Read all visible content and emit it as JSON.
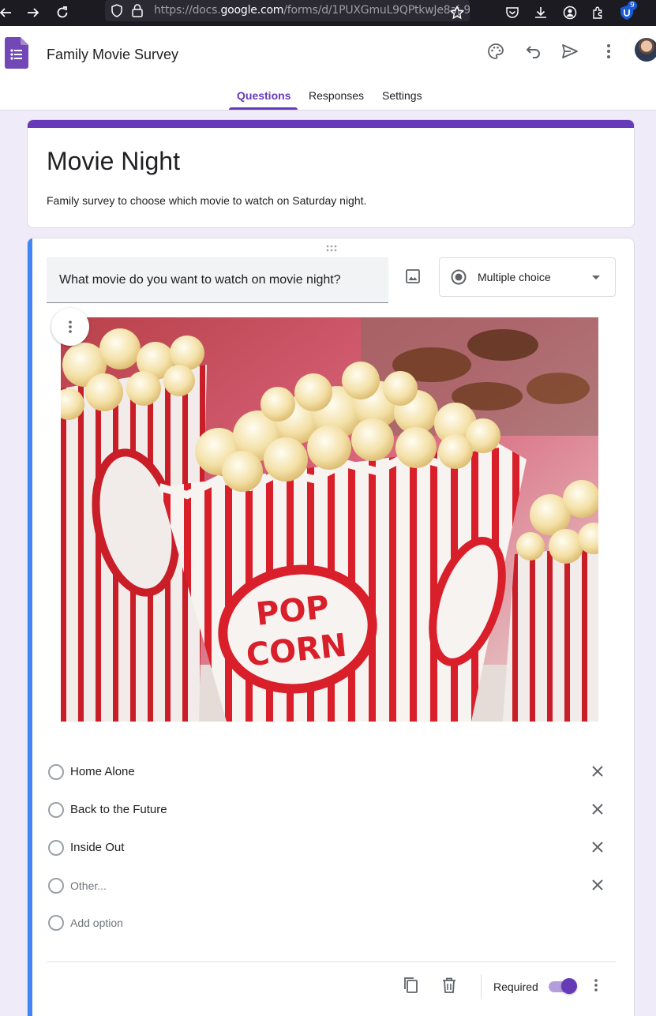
{
  "browser": {
    "url_prefix": "https://docs.",
    "url_domain": "google.com",
    "url_path": "/forms/d/1PUXGmuL9QPtkwJe8aj-9",
    "extension_badge": "9"
  },
  "header": {
    "doc_title": "Family Movie Survey"
  },
  "tabs": [
    {
      "label": "Questions",
      "active": true
    },
    {
      "label": "Responses",
      "active": false
    },
    {
      "label": "Settings",
      "active": false
    }
  ],
  "form": {
    "title": "Movie Night",
    "description": "Family survey to choose which movie to watch on Saturday night."
  },
  "question": {
    "text": "What movie do you want to watch on movie night?",
    "type": "Multiple choice",
    "image_lettering": [
      "POP",
      "CORN"
    ],
    "options": [
      {
        "label": "Home Alone"
      },
      {
        "label": "Back to the Future"
      },
      {
        "label": "Inside Out"
      },
      {
        "label": "Other..."
      }
    ],
    "add_option_label": "Add option",
    "required_label": "Required",
    "required": true
  },
  "colors": {
    "brand": "#673ab7",
    "accent": "#4285f4",
    "background": "#f0ebf8"
  }
}
